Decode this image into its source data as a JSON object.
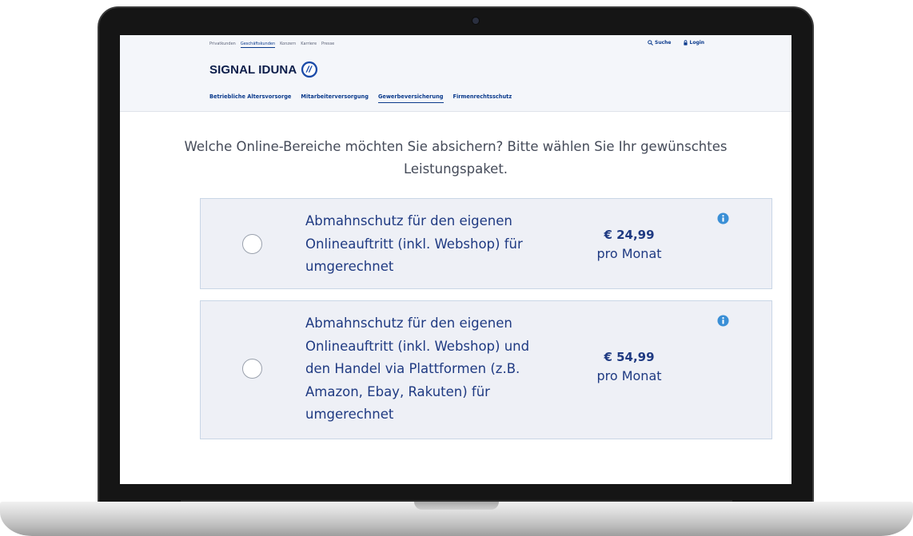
{
  "header": {
    "topnav": [
      "Privatkunden",
      "Geschäftskunden",
      "Konzern",
      "Karriere",
      "Presse"
    ],
    "topnav_active_index": 1,
    "search_label": "Suche",
    "login_label": "Login",
    "logo_text": "SIGNAL IDUNA",
    "mainnav": [
      "Betriebliche Altersvorsorge",
      "Mitarbeiterversorgung",
      "Gewerbeversicherung",
      "Firmenrechtsschutz"
    ],
    "mainnav_active_index": 2
  },
  "question": {
    "line1": "Welche Online-Bereiche möchten Sie absichern? Bitte wählen Sie Ihr gewünschtes",
    "line2": "Leistungspaket."
  },
  "options": [
    {
      "selected": false,
      "description_lines": [
        "Abmahnschutz für den eigenen",
        "Onlineauftritt (inkl. Webshop) für",
        "umgerechnet"
      ],
      "price": "€ 24,99",
      "period": "pro Monat",
      "icon": "info-icon"
    },
    {
      "selected": false,
      "description_lines": [
        "Abmahnschutz für den eigenen",
        "Onlineauftritt (inkl. Webshop) und",
        "den Handel via Plattformen (z.B.",
        "Amazon, Ebay, Rakuten) für",
        "umgerechnet"
      ],
      "price": "€ 54,99",
      "period": "pro Monat",
      "icon": "info-icon"
    }
  ],
  "colors": {
    "brand_blue": "#0a3a8c",
    "text_blue": "#1f3a82",
    "info_blue": "#3a8fd6",
    "card_bg": "#eef0f6",
    "card_border": "#c9d6e6"
  }
}
